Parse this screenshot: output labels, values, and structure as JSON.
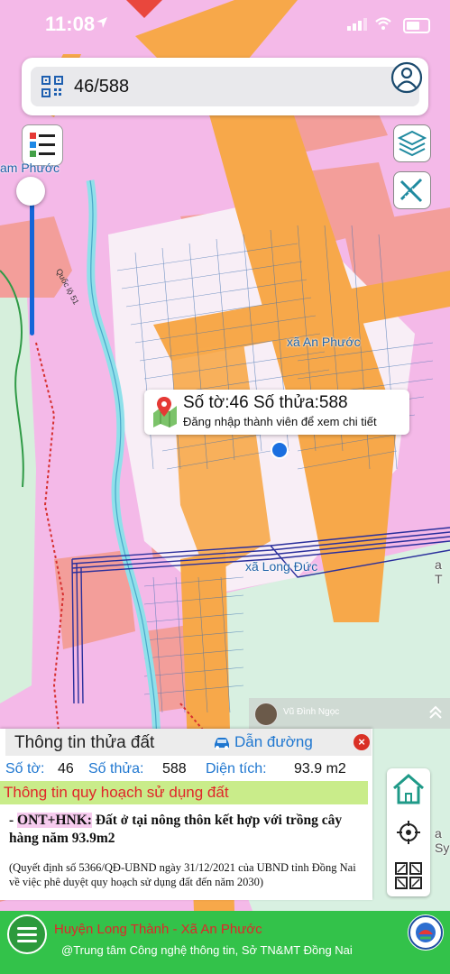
{
  "status_bar": {
    "time": "11:08"
  },
  "search": {
    "value": "46/588"
  },
  "map": {
    "labels": {
      "an_phuoc_edge": "am Phước",
      "xa_an_phuoc": "xã An Phước",
      "xa_long_duc": "xã Long Đức",
      "road": "Quốc lộ 51",
      "right_edge_1": "a T",
      "right_edge_2": "a Sy",
      "highway_badge": "51"
    }
  },
  "callout": {
    "title": "Số tờ:46 Số thửa:588",
    "subtitle": "Đăng nhập thành viên để xem chi tiết"
  },
  "user_bar": {
    "name": "Vũ Đình Ngọc"
  },
  "panel": {
    "title": "Thông tin thửa đất",
    "directions_label": "Dẫn đường",
    "so_to_label": "Số tờ:",
    "so_to_value": "46",
    "so_thua_label": "Số thửa:",
    "so_thua_value": "588",
    "dien_tich_label": "Diện tích:",
    "dien_tich_value": "93.9 m2",
    "section_title": "Thông tin quy hoạch sử dụng đất",
    "land_code": "ONT+HNK:",
    "land_desc": "Đất ở tại nông thôn kết hợp với trồng cây hàng năm 93.9m2",
    "note": "(Quyết định số 5366/QĐ-UBND ngày 31/12/2021 của UBND tỉnh Đồng Nai về việc phê duyệt quy hoạch sử dụng đất đến năm 2030)"
  },
  "bottom_bar": {
    "location": "Huyện Long Thành - Xã An Phước",
    "credit": "@Trung tâm Công nghệ thông tin, Sở TN&MT Đồng Nai"
  },
  "colors": {
    "residential": "#f4b9e8",
    "road": "#f7a84a",
    "green_zone": "#d8f0e1",
    "accent_blue": "#1f77d0",
    "bottom_green": "#33c24a"
  }
}
